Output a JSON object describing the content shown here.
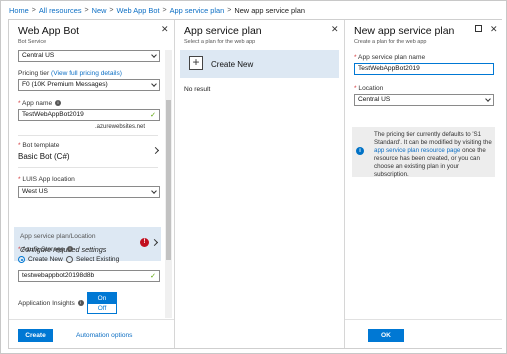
{
  "breadcrumb": {
    "items": [
      "Home",
      "All resources",
      "New",
      "Web App Bot",
      "App service plan",
      "New app service plan"
    ],
    "separator": ">"
  },
  "blade1": {
    "title": "Web App Bot",
    "subtitle": "Bot Service",
    "close": "✕",
    "location_value": "Central US",
    "pricing_label": "Pricing tier",
    "pricing_link": "(View full pricing details)",
    "pricing_value": "F0 (10K Premium Messages)",
    "app_name_label": "App name",
    "app_name_value": "TestWebAppBot2019",
    "app_name_suffix": ".azurewebsites.net",
    "bot_template_label": "Bot template",
    "bot_template_value": "Basic Bot (C#)",
    "luis_label": "LUIS App location",
    "luis_value": "West US",
    "asp_label": "App service plan/Location",
    "asp_value": "Configure required settings",
    "asp_error": "!",
    "storage_label": "Azure Storage",
    "radio_create": "Create New",
    "radio_existing": "Select Existing",
    "storage_value": "testwebappbot20198d8b",
    "insights_label": "Application Insights",
    "toggle_on": "On",
    "toggle_off": "Off",
    "create_button": "Create",
    "automation_link": "Automation options"
  },
  "blade2": {
    "title": "App service plan",
    "subtitle": "Select a plan for the web app",
    "close": "✕",
    "create_new": "Create New",
    "plus": "+",
    "no_result": "No result"
  },
  "blade3": {
    "title": "New app service plan",
    "subtitle": "Create a plan for the web app",
    "close": "✕",
    "name_label": "App service plan name",
    "name_value": "TestWebAppBot2019",
    "location_label": "Location",
    "location_value": "Central US",
    "info_text_1": "The pricing tier currently defaults to 'S1 Standard'. It can be modified by visiting the ",
    "info_link": "app service plan resource page",
    "info_text_2": " once the resource has been created, or you can choose an existing plan in your subscription.",
    "ok_button": "OK"
  },
  "colors": {
    "accent": "#0078d4",
    "link": "#0d6fc4",
    "error": "#c10f1f",
    "success": "#57a300",
    "selected_bg": "#dde8f3"
  }
}
